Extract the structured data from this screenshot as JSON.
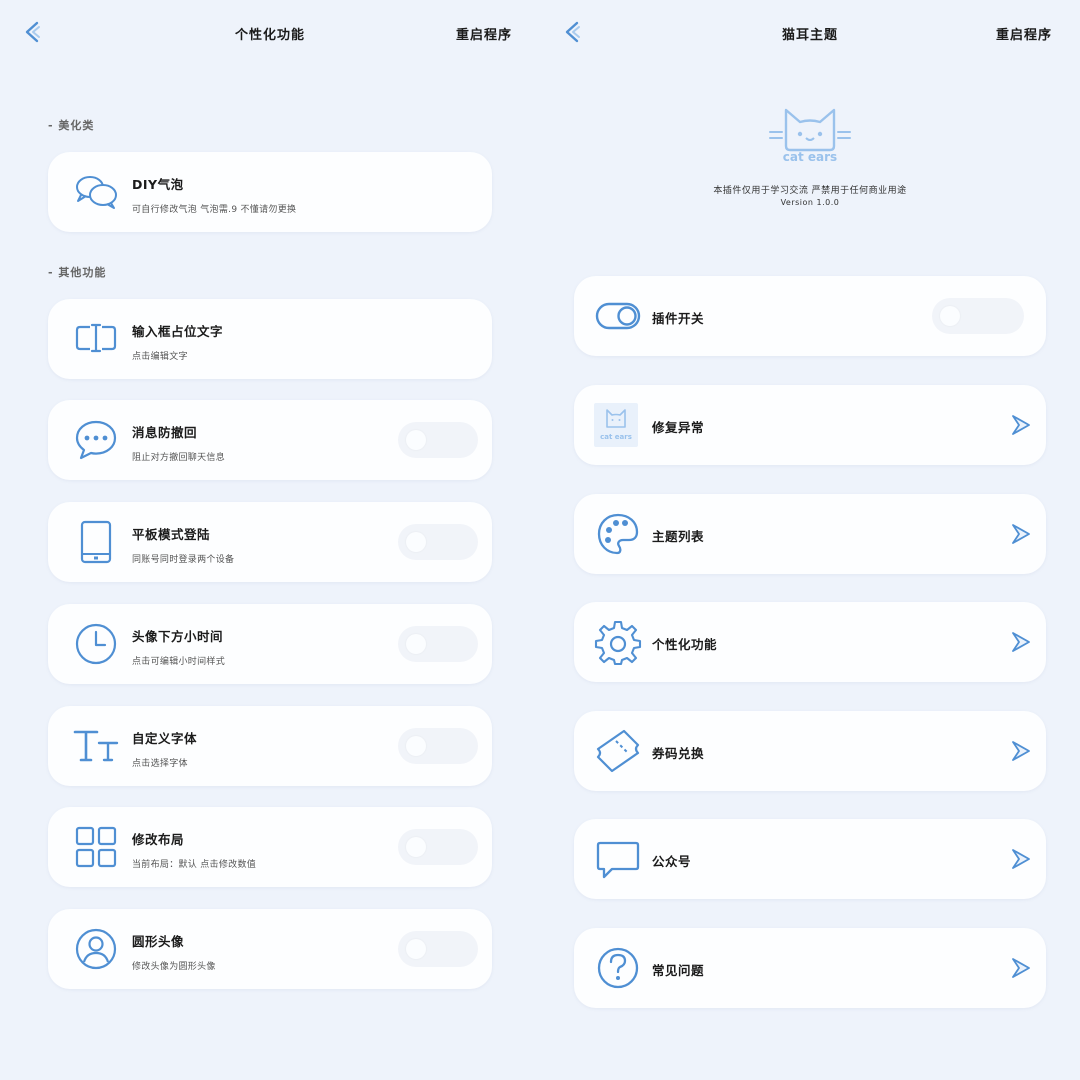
{
  "colors": {
    "accent": "#4f8fd3",
    "background": "#eef3fb",
    "card": "#fdfeff",
    "logo": "#9ac2ec"
  },
  "left": {
    "title": "个性化功能",
    "restart_label": "重启程序",
    "sections": [
      {
        "label": "- 美化类"
      },
      {
        "label": "- 其他功能"
      }
    ],
    "items": [
      {
        "title": "DIY气泡",
        "subtitle": "可自行修改气泡 气泡需.9 不懂请勿更换",
        "icon": "chat-bubbles-icon"
      },
      {
        "title": "输入框占位文字",
        "subtitle": "点击编辑文字",
        "icon": "text-cursor-icon"
      },
      {
        "title": "消息防撤回",
        "subtitle": "阻止对方撤回聊天信息",
        "icon": "message-dots-icon"
      },
      {
        "title": "平板模式登陆",
        "subtitle": "同账号同时登录两个设备",
        "icon": "tablet-icon"
      },
      {
        "title": "头像下方小时间",
        "subtitle": "点击可编辑小时间样式",
        "icon": "clock-icon"
      },
      {
        "title": "自定义字体",
        "subtitle": "点击选择字体",
        "icon": "font-icon"
      },
      {
        "title": "修改布局",
        "subtitle": "当前布局：默认 点击修改数值",
        "icon": "grid-icon"
      },
      {
        "title": "圆形头像",
        "subtitle": "修改头像为圆形头像",
        "icon": "user-circle-icon"
      }
    ]
  },
  "right": {
    "title": "猫耳主题",
    "restart_label": "重启程序",
    "logo_text": "cat ears",
    "disclaimer": "本插件仅用于学习交流 严禁用于任何商业用途",
    "version": "Version 1.0.0",
    "items": [
      {
        "title": "插件开关",
        "icon": "toggle-icon"
      },
      {
        "title": "修复异常",
        "icon": "cat-ears-thumbnail",
        "thumb_text": "cat ears"
      },
      {
        "title": "主题列表",
        "icon": "palette-icon"
      },
      {
        "title": "个性化功能",
        "icon": "gear-icon"
      },
      {
        "title": "券码兑换",
        "icon": "ticket-icon"
      },
      {
        "title": "公众号",
        "icon": "message-square-icon"
      },
      {
        "title": "常见问题",
        "icon": "help-circle-icon"
      }
    ]
  }
}
